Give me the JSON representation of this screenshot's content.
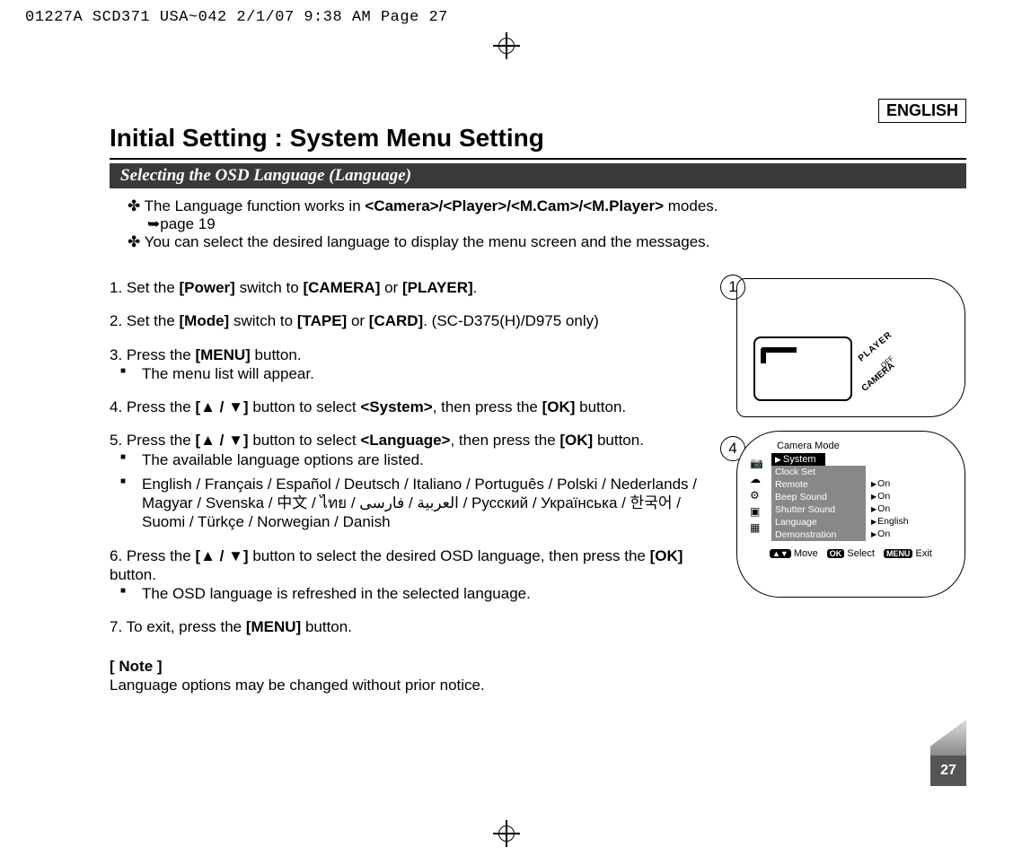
{
  "print_header": "01227A SCD371 USA~042  2/1/07 9:38 AM  Page 27",
  "lang_box": "ENGLISH",
  "title": "Initial Setting : System Menu Setting",
  "section_bar": "Selecting the OSD Language (Language)",
  "intro": {
    "line1_prefix": "✤ The Language function works in ",
    "line1_bold": "<Camera>/<Player>/<M.Cam>/<M.Player>",
    "line1_suffix": " modes.",
    "sub": "➥page 19",
    "line2": "✤ You can select the desired language to display the menu screen and the messages."
  },
  "steps": {
    "s1a": "1. Set the ",
    "s1b": "[Power]",
    "s1c": " switch to ",
    "s1d": "[CAMERA]",
    "s1e": " or ",
    "s1f": "[PLAYER]",
    "s1g": ".",
    "s2a": "2. Set the ",
    "s2b": "[Mode]",
    "s2c": " switch to ",
    "s2d": "[TAPE]",
    "s2e": " or ",
    "s2f": "[CARD]",
    "s2g": ". (SC-D375(H)/D975 only)",
    "s3a": "3. Press the ",
    "s3b": "[MENU]",
    "s3c": " button.",
    "s3_li": "The menu list will appear.",
    "s4a": "4. Press the ",
    "s4b": "[▲ / ▼]",
    "s4c": " button to select ",
    "s4d": "<System>",
    "s4e": ", then press the ",
    "s4f": "[OK]",
    "s4g": " button.",
    "s5a": "5. Press the ",
    "s5b": "[▲ / ▼]",
    "s5c": " button to select ",
    "s5d": "<Language>",
    "s5e": ", then press the ",
    "s5f": "[OK]",
    "s5g": " button.",
    "s5_li1": "The available language options are listed.",
    "s5_li2": "English / Français / Español / Deutsch / Italiano / Português / Polski / Nederlands / Magyar / Svenska / 中文 / ไทย / العربية / فارسی / Русский / Українська / 한국어 / Suomi / Türkçe / Norwegian / Danish",
    "s6a": "6. Press the ",
    "s6b": "[▲ / ▼]",
    "s6c": " button to select the desired OSD language, then press the ",
    "s6d": "[OK]",
    "s6e": " button.",
    "s6_li": "The OSD language is refreshed in the selected language.",
    "s7a": "7. To exit, press the ",
    "s7b": "[MENU]",
    "s7c": " button."
  },
  "note": {
    "heading": "[ Note ]",
    "body": "Language options may be changed without prior notice."
  },
  "fig1": {
    "callout": "1",
    "player": "PLAYER",
    "off": "OFF",
    "camera": "CAMERA"
  },
  "fig4": {
    "callout": "4",
    "title": "Camera Mode",
    "subtitle": "System",
    "rows": [
      {
        "label": "Clock Set",
        "value": ""
      },
      {
        "label": "Remote",
        "value": "On"
      },
      {
        "label": "Beep Sound",
        "value": "On"
      },
      {
        "label": "Shutter Sound",
        "value": "On"
      },
      {
        "label": "Language",
        "value": "English"
      },
      {
        "label": "Demonstration",
        "value": "On"
      }
    ],
    "hint_move_icon": "▲▼",
    "hint_move": "Move",
    "hint_ok_pill": "OK",
    "hint_ok": "Select",
    "hint_menu_pill": "MENU",
    "hint_menu": "Exit"
  },
  "page_number": "27"
}
